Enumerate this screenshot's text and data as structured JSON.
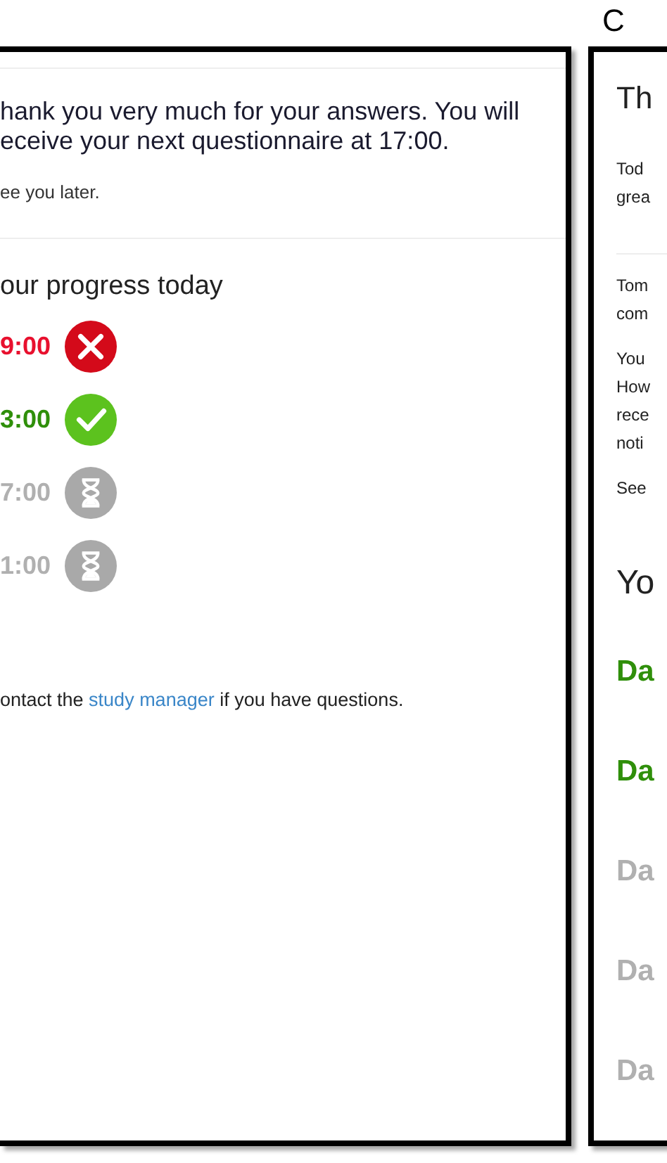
{
  "panel_b": {
    "message_lines": [
      "hank you very much for your answers. You will",
      "eceive your next questionnaire at 17:00."
    ],
    "farewell": "ee you later.",
    "progress_title": "our progress today",
    "sessions": [
      {
        "time": "9:00",
        "kind": "missed"
      },
      {
        "time": "3:00",
        "kind": "done"
      },
      {
        "time": "7:00",
        "kind": "pending"
      },
      {
        "time": "1:00",
        "kind": "pending"
      }
    ],
    "footer": {
      "before": "ontact the ",
      "link": "study manager",
      "after": " if you have questions."
    }
  },
  "panel_c": {
    "label": "C",
    "title": "Th",
    "groups": [
      [
        "Tod",
        "grea"
      ],
      [
        "Tom",
        "com"
      ],
      [
        "You",
        "How",
        "rece",
        "noti"
      ],
      [
        "See"
      ]
    ],
    "progress_title": "Yo",
    "days": [
      {
        "text": "Da",
        "kind": "done"
      },
      {
        "text": "Da",
        "kind": "done"
      },
      {
        "text": "Da",
        "kind": "pending"
      },
      {
        "text": "Da",
        "kind": "pending"
      },
      {
        "text": "Da",
        "kind": "pending"
      }
    ]
  }
}
